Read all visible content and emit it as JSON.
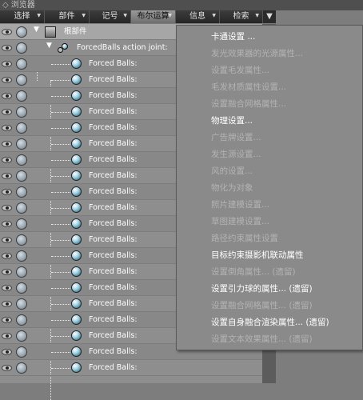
{
  "window": {
    "title": "浏览器"
  },
  "menubar": {
    "tabs": [
      "选择",
      "部件",
      "记号",
      "布尔运算",
      "信息",
      "检索"
    ]
  },
  "tree": {
    "root_label": "根部件",
    "joint_label": "ForcedBalls action joint:",
    "child_label": "Forced Balls:"
  },
  "context_menu": {
    "items": [
      {
        "label": "卡通设置 ...",
        "enabled": true
      },
      {
        "label": "发光效果器的光源属性...",
        "enabled": false
      },
      {
        "label": "设置毛发属性...",
        "enabled": false
      },
      {
        "label": "毛发材质属性设置...",
        "enabled": false
      },
      {
        "label": "设置融合网格属性...",
        "enabled": false
      },
      {
        "label": "物理设置...",
        "enabled": true
      },
      {
        "label": "广告牌设置...",
        "enabled": false
      },
      {
        "label": "发生源设置...",
        "enabled": false
      },
      {
        "label": "风的设置...",
        "enabled": false
      },
      {
        "label": "物化为对象",
        "enabled": false
      },
      {
        "label": "照片建模设置...",
        "enabled": false
      },
      {
        "label": "草图建模设置...",
        "enabled": false
      },
      {
        "label": "路径约束属性设置",
        "enabled": false
      },
      {
        "label": "目标约束摄影机联动属性",
        "enabled": true
      },
      {
        "label": "设置倒角属性... (遗留)",
        "enabled": false
      },
      {
        "label": "设置引力球的属性... (遗留)",
        "enabled": true
      },
      {
        "label": "设置融合网格属性... (遗留)",
        "enabled": false
      },
      {
        "label": "设置自身融合渲染属性... (遗留)",
        "enabled": true
      },
      {
        "label": "设置文本效果属性... (遗留)",
        "enabled": false
      }
    ]
  }
}
